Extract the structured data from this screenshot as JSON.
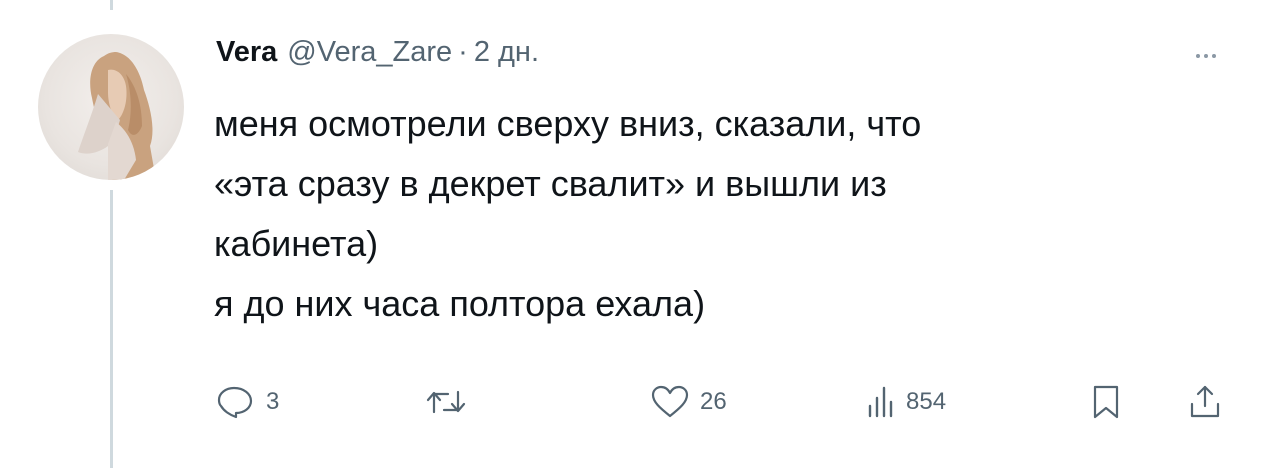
{
  "tweet": {
    "author_name": "Vera",
    "author_handle": "@Vera_Zare",
    "separator": "·",
    "time_ago": "2 дн.",
    "lines": [
      "меня осмотрели сверху вниз, сказали, что",
      "«эта сразу в декрет свалит» и вышли из",
      "кабинета)",
      "я до них часа полтора ехала)"
    ]
  },
  "actions": {
    "reply": {
      "icon": "reply-icon",
      "count": "3"
    },
    "retweet": {
      "icon": "retweet-icon",
      "count": ""
    },
    "like": {
      "icon": "heart-icon",
      "count": "26"
    },
    "views": {
      "icon": "views-icon",
      "count": "854"
    },
    "bookmark": {
      "icon": "bookmark-icon"
    },
    "share": {
      "icon": "share-icon"
    }
  },
  "colors": {
    "text": "#0f1419",
    "secondary": "#536471",
    "thread_line": "#cfd9de"
  }
}
